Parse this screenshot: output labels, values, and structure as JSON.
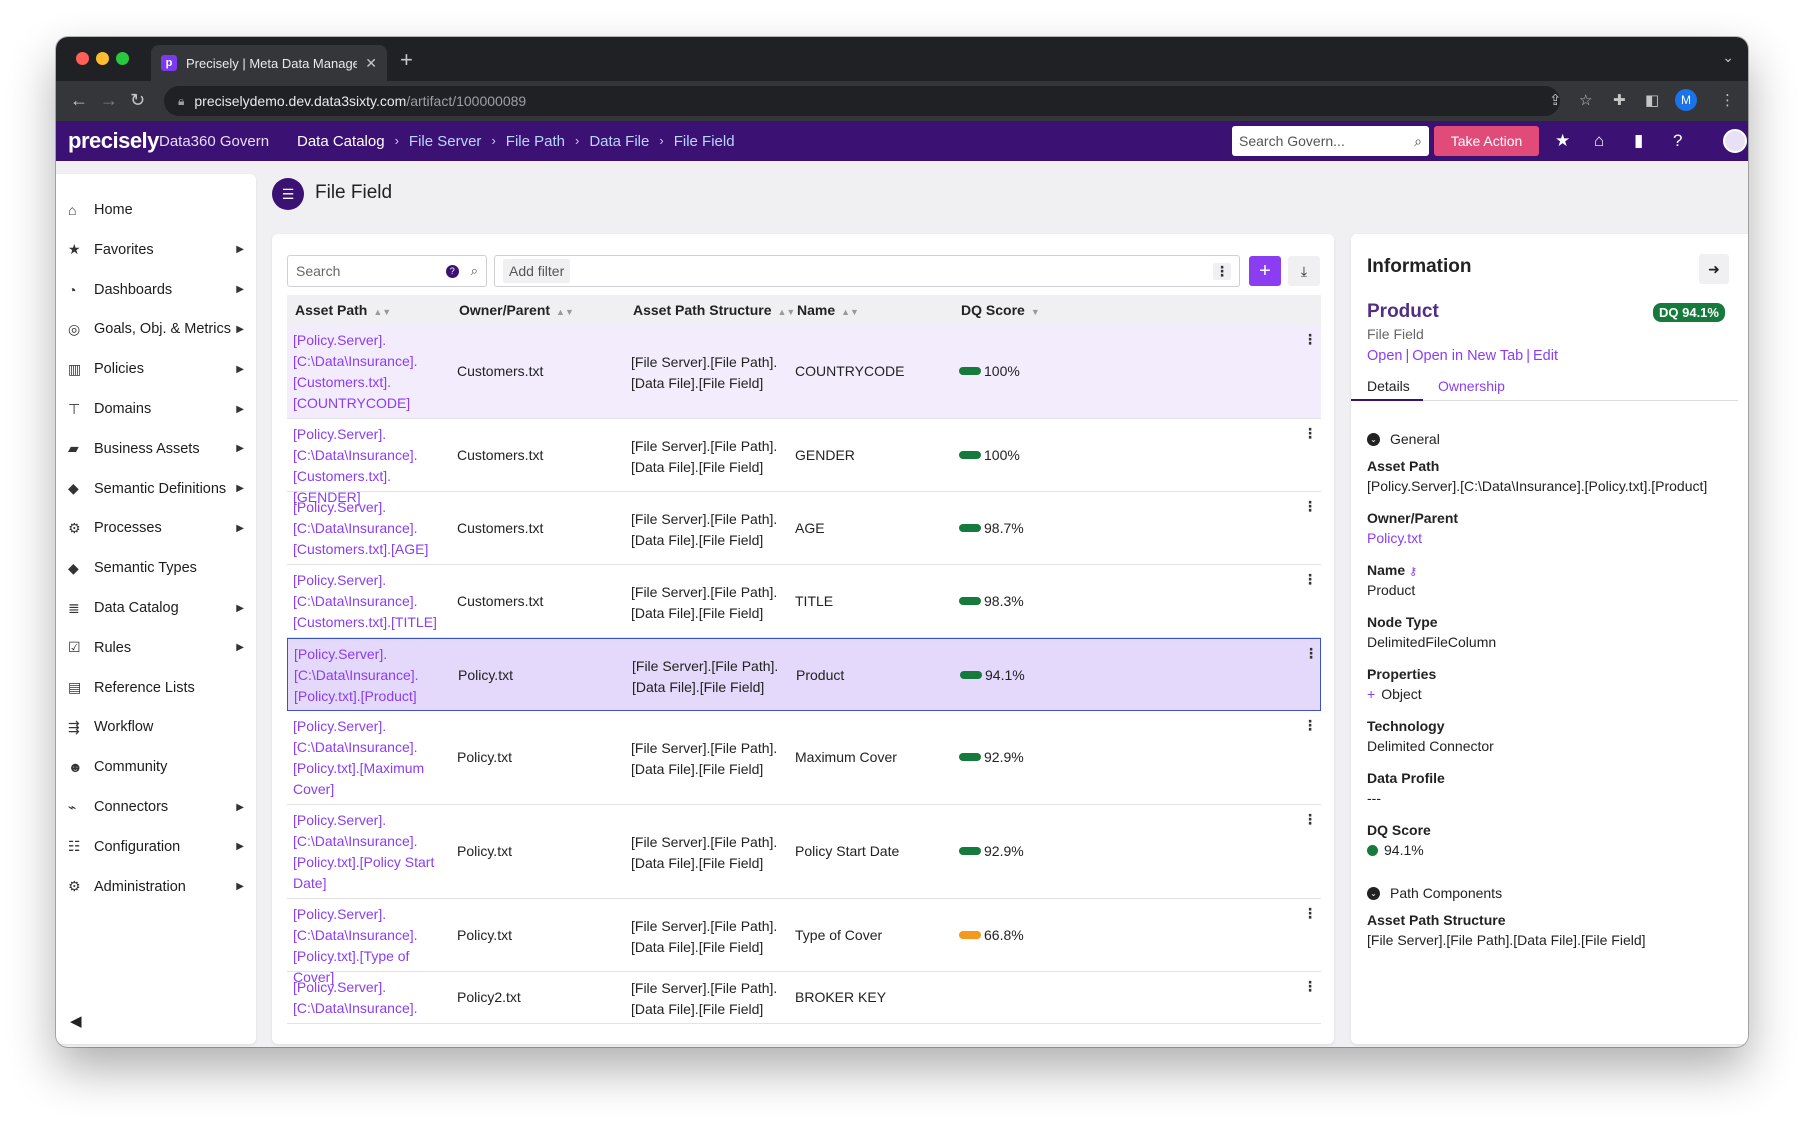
{
  "browser": {
    "tab_title": "Precisely | Meta Data Managem",
    "url_host": "preciselydemo.dev.data3sixty.com",
    "url_path": "/artifact/100000089",
    "profile_initial": "M"
  },
  "header": {
    "logo": "precisely",
    "product": "Data360 Govern",
    "breadcrumbs": [
      "Data Catalog",
      "File Server",
      "File Path",
      "Data File",
      "File Field"
    ],
    "search_placeholder": "Search Govern...",
    "take_action": "Take Action"
  },
  "sidebar": {
    "items": [
      {
        "label": "Home",
        "icon": "home-icon",
        "caret": false
      },
      {
        "label": "Favorites",
        "icon": "star-icon",
        "caret": true
      },
      {
        "label": "Dashboards",
        "icon": "dashboard-icon",
        "caret": true
      },
      {
        "label": "Goals, Obj. & Metrics",
        "icon": "target-icon",
        "caret": true
      },
      {
        "label": "Policies",
        "icon": "building-icon",
        "caret": true
      },
      {
        "label": "Domains",
        "icon": "sitemap-icon",
        "caret": true
      },
      {
        "label": "Business Assets",
        "icon": "book-icon",
        "caret": true
      },
      {
        "label": "Semantic Definitions",
        "icon": "tags-icon",
        "caret": true
      },
      {
        "label": "Processes",
        "icon": "cogs-icon",
        "caret": true
      },
      {
        "label": "Semantic Types",
        "icon": "tag-icon",
        "caret": false
      },
      {
        "label": "Data Catalog",
        "icon": "database-icon",
        "caret": true
      },
      {
        "label": "Rules",
        "icon": "checkbox-icon",
        "caret": true
      },
      {
        "label": "Reference Lists",
        "icon": "list-icon",
        "caret": false
      },
      {
        "label": "Workflow",
        "icon": "workflow-icon",
        "caret": false
      },
      {
        "label": "Community",
        "icon": "users-icon",
        "caret": false
      },
      {
        "label": "Connectors",
        "icon": "plug-icon",
        "caret": true
      },
      {
        "label": "Configuration",
        "icon": "sliders-icon",
        "caret": true
      },
      {
        "label": "Administration",
        "icon": "gear-icon",
        "caret": true
      }
    ]
  },
  "page": {
    "title": "File Field"
  },
  "toolbar": {
    "search_placeholder": "Search",
    "filter_label": "Add filter",
    "add_label": "+"
  },
  "table": {
    "headers": [
      "Asset Path",
      "Owner/Parent",
      "Asset Path Structure",
      "Name",
      "DQ Score"
    ],
    "rows": [
      {
        "path": [
          "[Policy.Server].",
          "[C:\\Data\\Insurance].",
          "[Customers.txt].",
          "[COUNTRYCODE]"
        ],
        "owner": "Customers.txt",
        "structure": [
          "[File Server].[File Path].",
          "[Data File].[File Field]"
        ],
        "name": "COUNTRYCODE",
        "dq": "100%",
        "dq_color": "#157a3c"
      },
      {
        "path": [
          "[Policy.Server].",
          "[C:\\Data\\Insurance].",
          "[Customers.txt].[GENDER]"
        ],
        "owner": "Customers.txt",
        "structure": [
          "[File Server].[File Path].",
          "[Data File].[File Field]"
        ],
        "name": "GENDER",
        "dq": "100%",
        "dq_color": "#157a3c"
      },
      {
        "path": [
          "[Policy.Server].",
          "[C:\\Data\\Insurance].",
          "[Customers.txt].[AGE]"
        ],
        "owner": "Customers.txt",
        "structure": [
          "[File Server].[File Path].",
          "[Data File].[File Field]"
        ],
        "name": "AGE",
        "dq": "98.7%",
        "dq_color": "#157a3c"
      },
      {
        "path": [
          "[Policy.Server].",
          "[C:\\Data\\Insurance].",
          "[Customers.txt].[TITLE]"
        ],
        "owner": "Customers.txt",
        "structure": [
          "[File Server].[File Path].",
          "[Data File].[File Field]"
        ],
        "name": "TITLE",
        "dq": "98.3%",
        "dq_color": "#157a3c"
      },
      {
        "path": [
          "[Policy.Server].",
          "[C:\\Data\\Insurance].",
          "[Policy.txt].[Product]"
        ],
        "owner": "Policy.txt",
        "structure": [
          "[File Server].[File Path].",
          "[Data File].[File Field]"
        ],
        "name": "Product",
        "dq": "94.1%",
        "dq_color": "#157a3c"
      },
      {
        "path": [
          "[Policy.Server].",
          "[C:\\Data\\Insurance].",
          "[Policy.txt].[Maximum",
          "Cover]"
        ],
        "owner": "Policy.txt",
        "structure": [
          "[File Server].[File Path].",
          "[Data File].[File Field]"
        ],
        "name": "Maximum Cover",
        "dq": "92.9%",
        "dq_color": "#157a3c"
      },
      {
        "path": [
          "[Policy.Server].",
          "[C:\\Data\\Insurance].",
          "[Policy.txt].[Policy Start",
          "Date]"
        ],
        "owner": "Policy.txt",
        "structure": [
          "[File Server].[File Path].",
          "[Data File].[File Field]"
        ],
        "name": "Policy Start Date",
        "dq": "92.9%",
        "dq_color": "#157a3c"
      },
      {
        "path": [
          "[Policy.Server].",
          "[C:\\Data\\Insurance].",
          "[Policy.txt].[Type of Cover]"
        ],
        "owner": "Policy.txt",
        "structure": [
          "[File Server].[File Path].",
          "[Data File].[File Field]"
        ],
        "name": "Type of Cover",
        "dq": "66.8%",
        "dq_color": "#f39a1d"
      },
      {
        "path": [
          "[Policy.Server].",
          "[C:\\Data\\Insurance]."
        ],
        "owner": "Policy2.txt",
        "structure": [
          "[File Server].[File Path].",
          "[Data File].[File Field]"
        ],
        "name": "BROKER KEY",
        "dq": "",
        "dq_color": ""
      }
    ]
  },
  "info": {
    "title": "Information",
    "name": "Product",
    "dq_badge": "DQ 94.1%",
    "type": "File Field",
    "links": [
      "Open",
      "Open in New Tab",
      "Edit"
    ],
    "tabs": [
      "Details",
      "Ownership"
    ],
    "general_label": "General",
    "asset_path_label": "Asset Path",
    "asset_path": "[Policy.Server].[C:\\Data\\Insurance].[Policy.txt].[Product]",
    "owner_label": "Owner/Parent",
    "owner": "Policy.txt",
    "name_label": "Name",
    "name_value": "Product",
    "node_type_label": "Node Type",
    "node_type": "DelimitedFileColumn",
    "properties_label": "Properties",
    "properties": "Object",
    "technology_label": "Technology",
    "technology": "Delimited Connector",
    "data_profile_label": "Data Profile",
    "data_profile": "---",
    "dq_label": "DQ Score",
    "dq_value": "94.1%",
    "path_components_label": "Path Components",
    "aps_label": "Asset Path Structure",
    "aps_value": "[File Server].[File Path].[Data File].[File Field]"
  }
}
